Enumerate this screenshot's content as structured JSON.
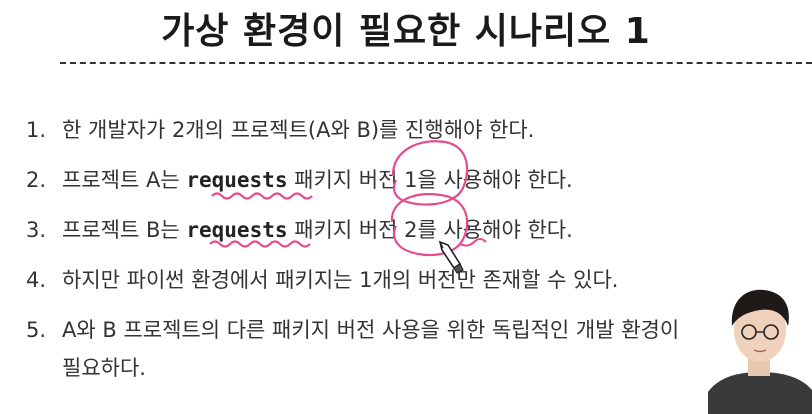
{
  "title": "가상 환경이 필요한 시나리오 1",
  "colors": {
    "text": "#333333",
    "highlight": "#c0392b",
    "annotation": "#e84a8f"
  },
  "bullets": [
    {
      "num": "1.",
      "text": "한 개발자가 2개의 프로젝트(A와 B)를 진행해야 한다."
    },
    {
      "num": "2.",
      "before": "프로젝트 A는 ",
      "code": "requests",
      "after": " 패키지 버전 1을 사용해야 한다."
    },
    {
      "num": "3.",
      "before": "프로젝트 B는 ",
      "code": "requests",
      "after": " 패키지 버전 2를 사용해야 한다."
    },
    {
      "num": "4.",
      "text": "하지만 파이썬 환경에서 패키지는 1개의 버전만 존재할 수 있다."
    },
    {
      "num": "5.",
      "before": "A와 B 프로젝트의 다른 패키지 버전 사용을 위한 ",
      "highlight": "독립적인 개발 환경",
      "after": "이",
      "continuation": "필요하다."
    }
  ],
  "icons": {
    "cursor": "pencil-cursor-icon"
  }
}
